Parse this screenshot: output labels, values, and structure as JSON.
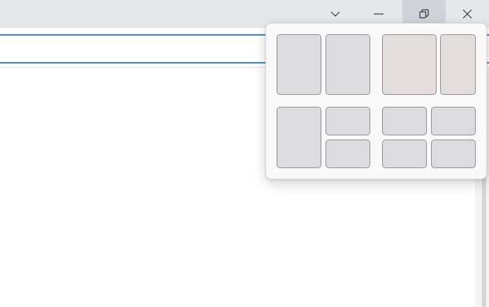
{
  "titlebar": {
    "buttons": {
      "dropdown": "chevron-down-icon",
      "minimize": "minimize-icon",
      "restore": "restore-icon",
      "close": "close-icon"
    }
  },
  "snap_layouts": {
    "layouts": [
      {
        "name": "two-columns-equal",
        "zones": 2
      },
      {
        "name": "two-columns-wide-left",
        "zones": 2
      },
      {
        "name": "column-left-two-stacked-right",
        "zones": 3
      },
      {
        "name": "grid-four-quadrants",
        "zones": 4
      }
    ]
  },
  "colors": {
    "titlebar": "#e5e7ea",
    "restore_hover": "#d0d3d8",
    "accent_line": "#3b7ddd",
    "flyout_background": "#f9f9fa",
    "zone_fill": "#dcdcde",
    "zone_border": "#8d8d8f"
  }
}
